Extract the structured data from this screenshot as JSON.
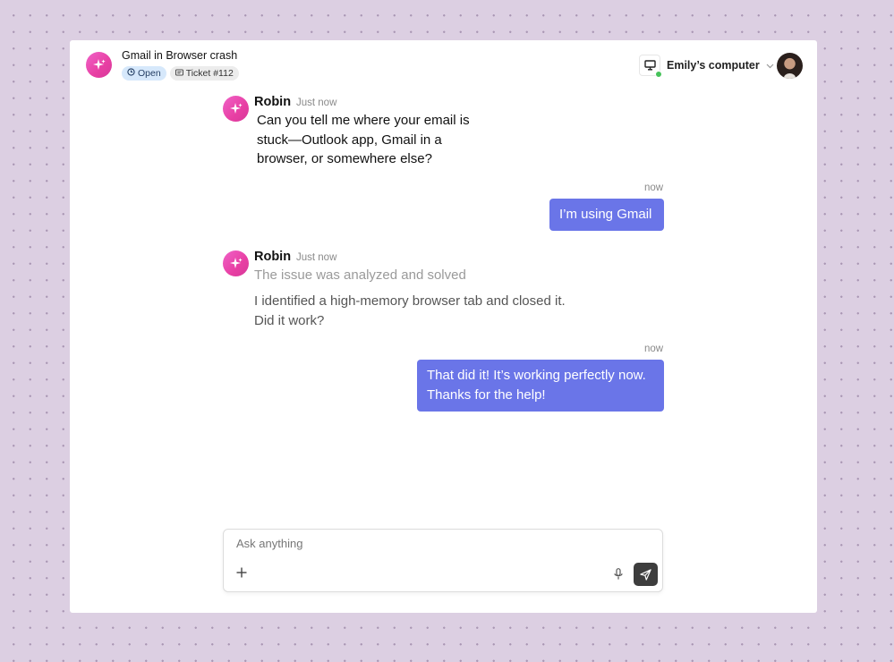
{
  "header": {
    "ticket_title": "Gmail in Browser crash",
    "status_badge": "Open",
    "ticket_badge": "Ticket #112",
    "computer_name": "Emily’s computer"
  },
  "messages": [
    {
      "role": "bot",
      "sender": "Robin",
      "time": "Just now",
      "lines": [
        "Can you tell me where your email is",
        "stuck—Outlook app, Gmail in a",
        "browser, or somewhere else?"
      ]
    },
    {
      "role": "user",
      "time": "now",
      "lines": [
        "I’m using Gmail"
      ]
    },
    {
      "role": "bot",
      "sender": "Robin",
      "time": "Just now",
      "status": "The issue was analyzed and solved",
      "lines": [
        "I identified a high-memory browser tab and closed it.",
        "Did it work?"
      ]
    },
    {
      "role": "user",
      "time": "now",
      "lines": [
        "That did it! It’s working perfectly now.",
        "Thanks for the help!"
      ]
    }
  ],
  "composer": {
    "placeholder": "Ask anything"
  },
  "icons": {
    "logo": "sparkle-icon",
    "status": "clock-icon",
    "ticket": "ticket-icon",
    "computer": "monitor-icon",
    "dropdown": "chevron-down-icon",
    "add": "plus-icon",
    "mic": "microphone-icon",
    "send": "send-icon"
  },
  "colors": {
    "accent_gradient_start": "#f062c8",
    "accent_gradient_end": "#d7399a",
    "user_bubble": "#6a75e8",
    "online": "#46c25a",
    "send_button": "#3d3d3d",
    "page_background": "#dccfe2"
  }
}
